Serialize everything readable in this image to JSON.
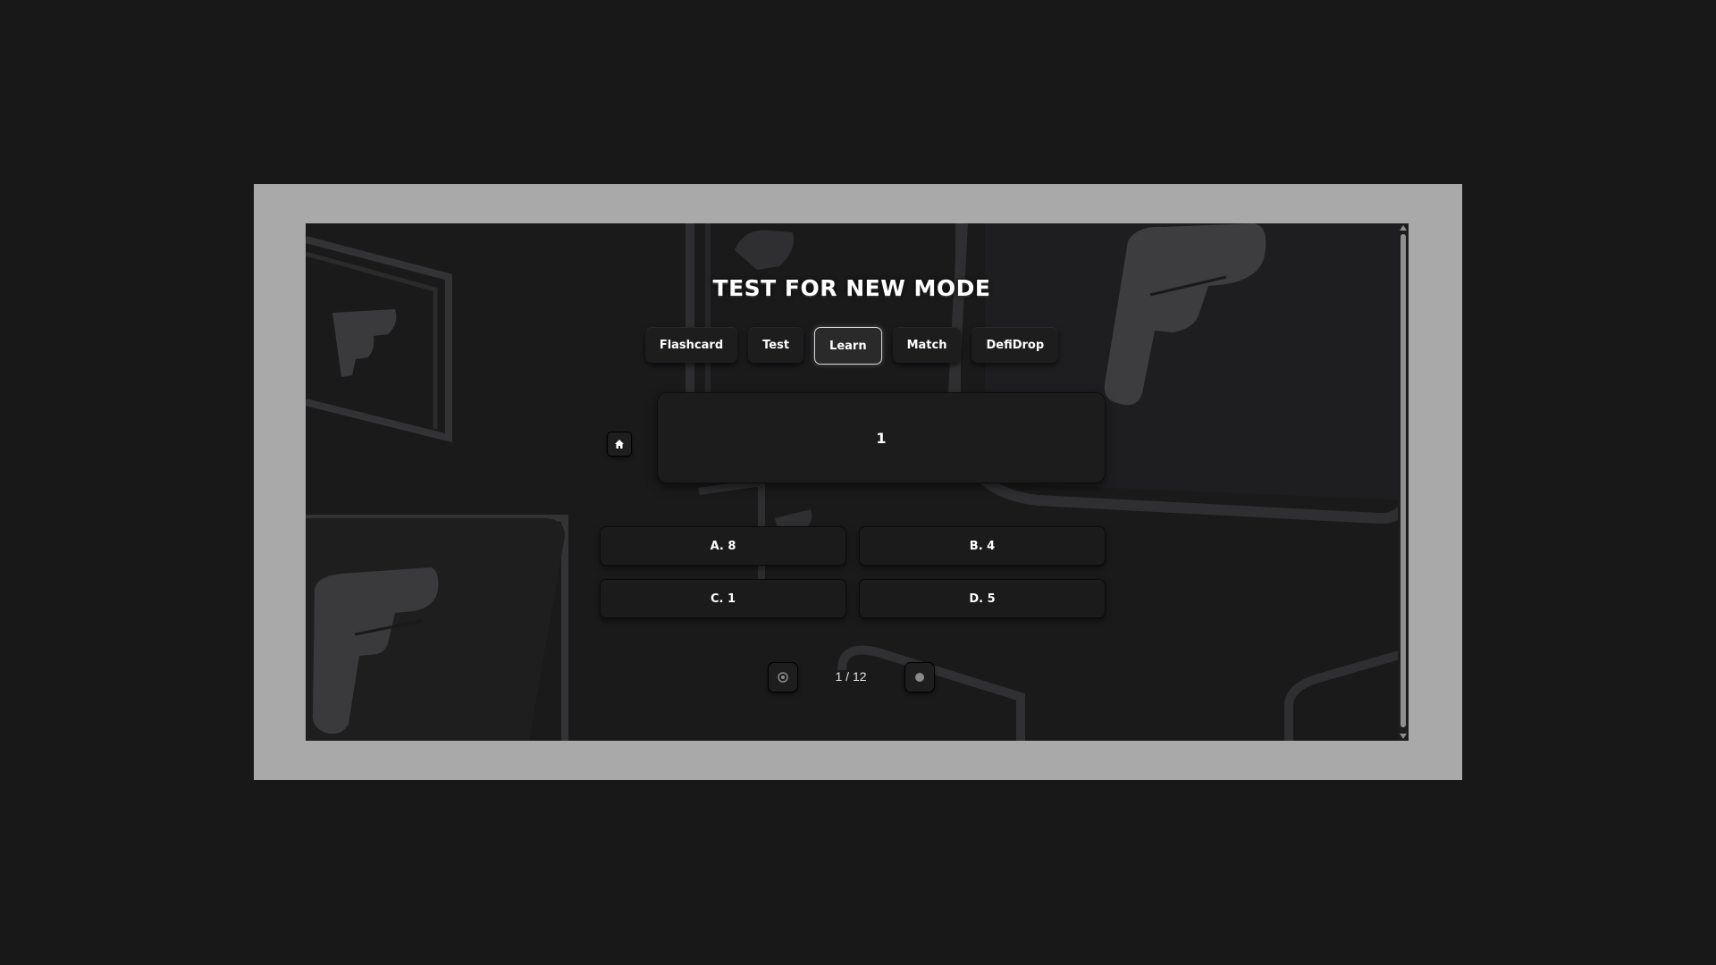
{
  "page": {
    "title": "TEST FOR NEW MODE"
  },
  "tabs": [
    {
      "label": "Flashcard",
      "active": false
    },
    {
      "label": "Test",
      "active": false
    },
    {
      "label": "Learn",
      "active": true
    },
    {
      "label": "Match",
      "active": false
    },
    {
      "label": "DefiDrop",
      "active": false
    }
  ],
  "question": {
    "text": "1"
  },
  "options": [
    {
      "label": "A. 8"
    },
    {
      "label": "B. 4"
    },
    {
      "label": "C. 1"
    },
    {
      "label": "D. 5"
    }
  ],
  "pager": {
    "text": "1 / 12",
    "current": 1,
    "total": 12
  },
  "icons": {
    "home": "home-icon",
    "prev": "circle-icon",
    "next": "circle-icon"
  },
  "colors": {
    "background": "#181819",
    "frame": "#a9a9a9",
    "panel": "#1a1a1b",
    "text": "#ffffff",
    "active_border": "#d8d8d8"
  }
}
